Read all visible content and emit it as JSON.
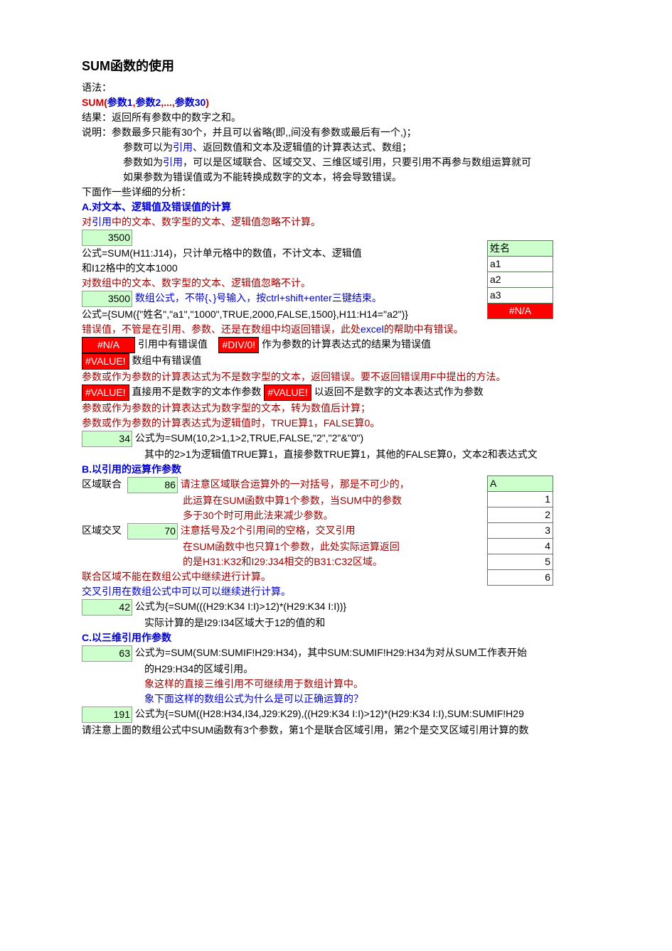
{
  "title": "SUM函数的使用",
  "syntax_label": "语法：",
  "syntax": {
    "pre": "SUM(",
    "arg1": "参数1",
    "sep1": ",",
    "arg2": "参数2",
    "sep2": ",...,",
    "arg3": "参数30",
    "post": ")"
  },
  "result_line": {
    "pre": "结果：返回所有参数中的数字之和。"
  },
  "desc_lines": [
    "说明：参数最多只能有30个，并且可以省略(即,,间没有参数或最后有一个,)；",
    "参数可以为",
    "引用",
    "、返回数值和文本及逻辑值的计算表达式、数组；",
    "参数如为",
    "引用",
    "，可以是区域联合、区域交叉、三维区域引用，只要引用不再参与数组运算就可",
    "如果参数为错误值或为不能转换成数字的文本，将会导致错误。"
  ],
  "detail_intro": "下面作一些详细的分析：",
  "A_title": "A.对文本、逻辑值及错误值的计算",
  "A1": {
    "pre": "对",
    "ref": "引用",
    "post": "中的文本、数字型的文本、逻辑值忽略不计算。"
  },
  "A_val1": "3500",
  "A_formula1": "公式=SUM(H11:J14)，只计单元格中的数值，不计文本、逻辑值",
  "A_formula1b": "和I12格中的文本1000",
  "A2": "对数组中的文本、数字型的文本、逻辑值忽略不计。",
  "A_val2": "3500",
  "A_arr_note": "数组公式，不带{、}号输入，按ctrl+shift+enter三键结束。",
  "A_formula2": "公式={SUM({\"姓名\",\"a1\",\"1000\",TRUE,2000,FALSE,1500},H11:H14=\"a2\")}",
  "A_err_intro": {
    "pre": "错误值，不管是在引用、参数、还是在数组中均返回错误，此处",
    "excel": "excel",
    "post": "的帮助中有错误。"
  },
  "A_err_na": "#N/A",
  "A_err_na_txt": "引用中有错误值",
  "A_err_div": "#DIV/0!",
  "A_err_div_txt": "作为参数的计算表达式的结果为错误值",
  "A_err_val": "#VALUE!",
  "A_err_val_txt": "数组中有错误值",
  "A_nontxt_line": "参数或作为参数的计算表达式为不是数字型的文本，返回错误。要不返回错误用F中提出的方法。",
  "A_val_err2": "#VALUE!",
  "A_val_err2_txt": "直接用不是数字的文本作参数",
  "A_val_err3": "#VALUE!",
  "A_val_err3_txt": "以返回不是数字的文本表达式作为参数",
  "A_numtxt": "参数或作为参数的计算表达式为数字型的文本，转为数值后计算；",
  "A_bool": "参数或作为参数的计算表达式为逻辑值时，TRUE算1，FALSE算0。",
  "A_val34": "34",
  "A_formula34": "公式为=SUM(10,2>1,1>2,TRUE,FALSE,\"2\",\"2\"&\"0\")",
  "A_formula34b": "其中的2>1为逻辑值TRUE算1，直接参数TRUE算1，其他的FALSE算0，文本2和表达式文",
  "B_title": "B.以引用的运算作参数",
  "B_union_lbl": "区域联合",
  "B_union_val": "86",
  "B_union_txt1": "请注意区域联合运算外的一对括号，那是不可少的，",
  "B_union_txt2": "此运算在SUM函数中算1个参数，当SUM中的参数",
  "B_union_txt3": "多于30个时可用此法来减少参数。",
  "B_cross_lbl": "区域交叉",
  "B_cross_val": "70",
  "B_cross_txt1": "注意括号及2个引用间的空格，交叉引用",
  "B_cross_txt2": "在SUM函数中也只算1个参数，此处实际运算返回",
  "B_cross_txt3": "的是H31:K32和I29:J34相交的B31:C32区域。",
  "B_union_no_arr": "联合区域不能在数组公式中继续进行计算。",
  "B_cross_arr": "交叉引用在数组公式中可以可以继续进行计算。",
  "B_val42": "42",
  "B_formula42": "公式为{=SUM(((H29:K34  I:I)>12)*(H29:K34  I:I))}",
  "B_formula42b": "实际计算的是I29:I34区域大于12的值的和",
  "C_title": "C.以三维引用作参数",
  "C_val63": "63",
  "C_formula63": "公式为=SUM(SUM:SUMIF!H29:H34)，其中SUM:SUMIF!H29:H34为对从SUM工作表开始",
  "C_formula63b": "的H29:H34的区域引用。",
  "C_3d_noarr": "象这样的直接三维引用不可继续用于数组计算中。",
  "C_why": "象下面这样的数组公式为什么是可以正确运算的？",
  "C_val191": "191",
  "C_formula191": "公式为{=SUM((H28:H34,I34,J29:K29),((H29:K34  I:I)>12)*(H29:K34  I:I),SUM:SUMIF!H29",
  "C_note": "请注意上面的数组公式中SUM函数有3个参数，第1个是联合区域引用，第2个是交叉区域引用计算的数",
  "right_tbl1": {
    "hdr": "姓名",
    "r1": "a1",
    "r2": "a2",
    "r3": "a3",
    "err": "#N/A"
  },
  "right_tbl2": {
    "hdr": "A",
    "r1": "1",
    "r2": "2",
    "r3": "3",
    "r4": "4",
    "r5": "5",
    "r6": "6"
  }
}
